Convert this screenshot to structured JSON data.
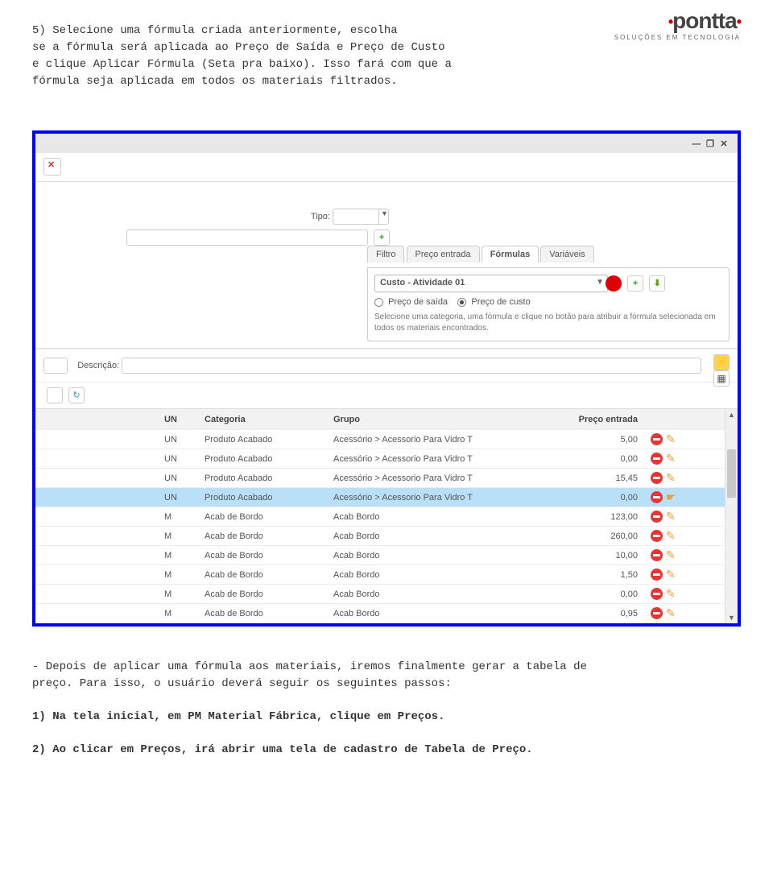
{
  "logo": {
    "name": "pontta",
    "tagline": "SOLUÇÕES EM TECNOLOGIA"
  },
  "doc": {
    "intro": "    5) Selecione uma fórmula criada anteriormente, escolha\nse a fórmula será aplicada ao Preço de Saída e Preço de Custo\ne clique Aplicar Fórmula (Seta pra baixo). Isso fará com que a\nfórmula seja aplicada em todos os materiais filtrados.",
    "outro1": "- Depois de aplicar uma fórmula aos materiais, iremos finalmente gerar a tabela de\npreço. Para isso, o usuário deverá seguir os seguintes passos:",
    "step1": "    1) Na tela inicial, em PM Material Fábrica, clique em Preços.",
    "step2": "    2) Ao clicar em Preços, irá abrir uma tela de cadastro de Tabela de Preço."
  },
  "app": {
    "tipo_label": "Tipo:",
    "desc_label": "Descrição:",
    "tabs": {
      "filtro": "Filtro",
      "preco_entrada": "Preço entrada",
      "formulas": "Fórmulas",
      "variaveis": "Variáveis"
    },
    "formula_select": "Custo - Atividade 01",
    "radio": {
      "saida": "Preço de saída",
      "custo": "Preço de custo"
    },
    "helper": "Selecione uma categoria, uma fórmula e clique no botão para\natribuir a fórmula selecionada em todos os materiais\nencontrados.",
    "grid": {
      "cols": {
        "un": "UN",
        "cat": "Categoria",
        "grp": "Grupo",
        "prc": "Preço entrada"
      },
      "rows": [
        {
          "un": "UN",
          "cat": "Produto Acabado",
          "grp": "Acessório > Acessorio Para Vidro T",
          "prc": "5,00",
          "sel": false
        },
        {
          "un": "UN",
          "cat": "Produto Acabado",
          "grp": "Acessório > Acessorio Para Vidro T",
          "prc": "0,00",
          "sel": false
        },
        {
          "un": "UN",
          "cat": "Produto Acabado",
          "grp": "Acessório > Acessorio Para Vidro T",
          "prc": "15,45",
          "sel": false
        },
        {
          "un": "UN",
          "cat": "Produto Acabado",
          "grp": "Acessório > Acessorio Para Vidro T",
          "prc": "0,00",
          "sel": true
        },
        {
          "un": "M",
          "cat": "Acab de Bordo",
          "grp": "Acab Bordo",
          "prc": "123,00",
          "sel": false
        },
        {
          "un": "M",
          "cat": "Acab de Bordo",
          "grp": "Acab Bordo",
          "prc": "260,00",
          "sel": false
        },
        {
          "un": "M",
          "cat": "Acab de Bordo",
          "grp": "Acab Bordo",
          "prc": "10,00",
          "sel": false
        },
        {
          "un": "M",
          "cat": "Acab de Bordo",
          "grp": "Acab Bordo",
          "prc": "1,50",
          "sel": false
        },
        {
          "un": "M",
          "cat": "Acab de Bordo",
          "grp": "Acab Bordo",
          "prc": "0,00",
          "sel": false
        },
        {
          "un": "M",
          "cat": "Acab de Bordo",
          "grp": "Acab Bordo",
          "prc": "0,95",
          "sel": false
        }
      ]
    }
  }
}
